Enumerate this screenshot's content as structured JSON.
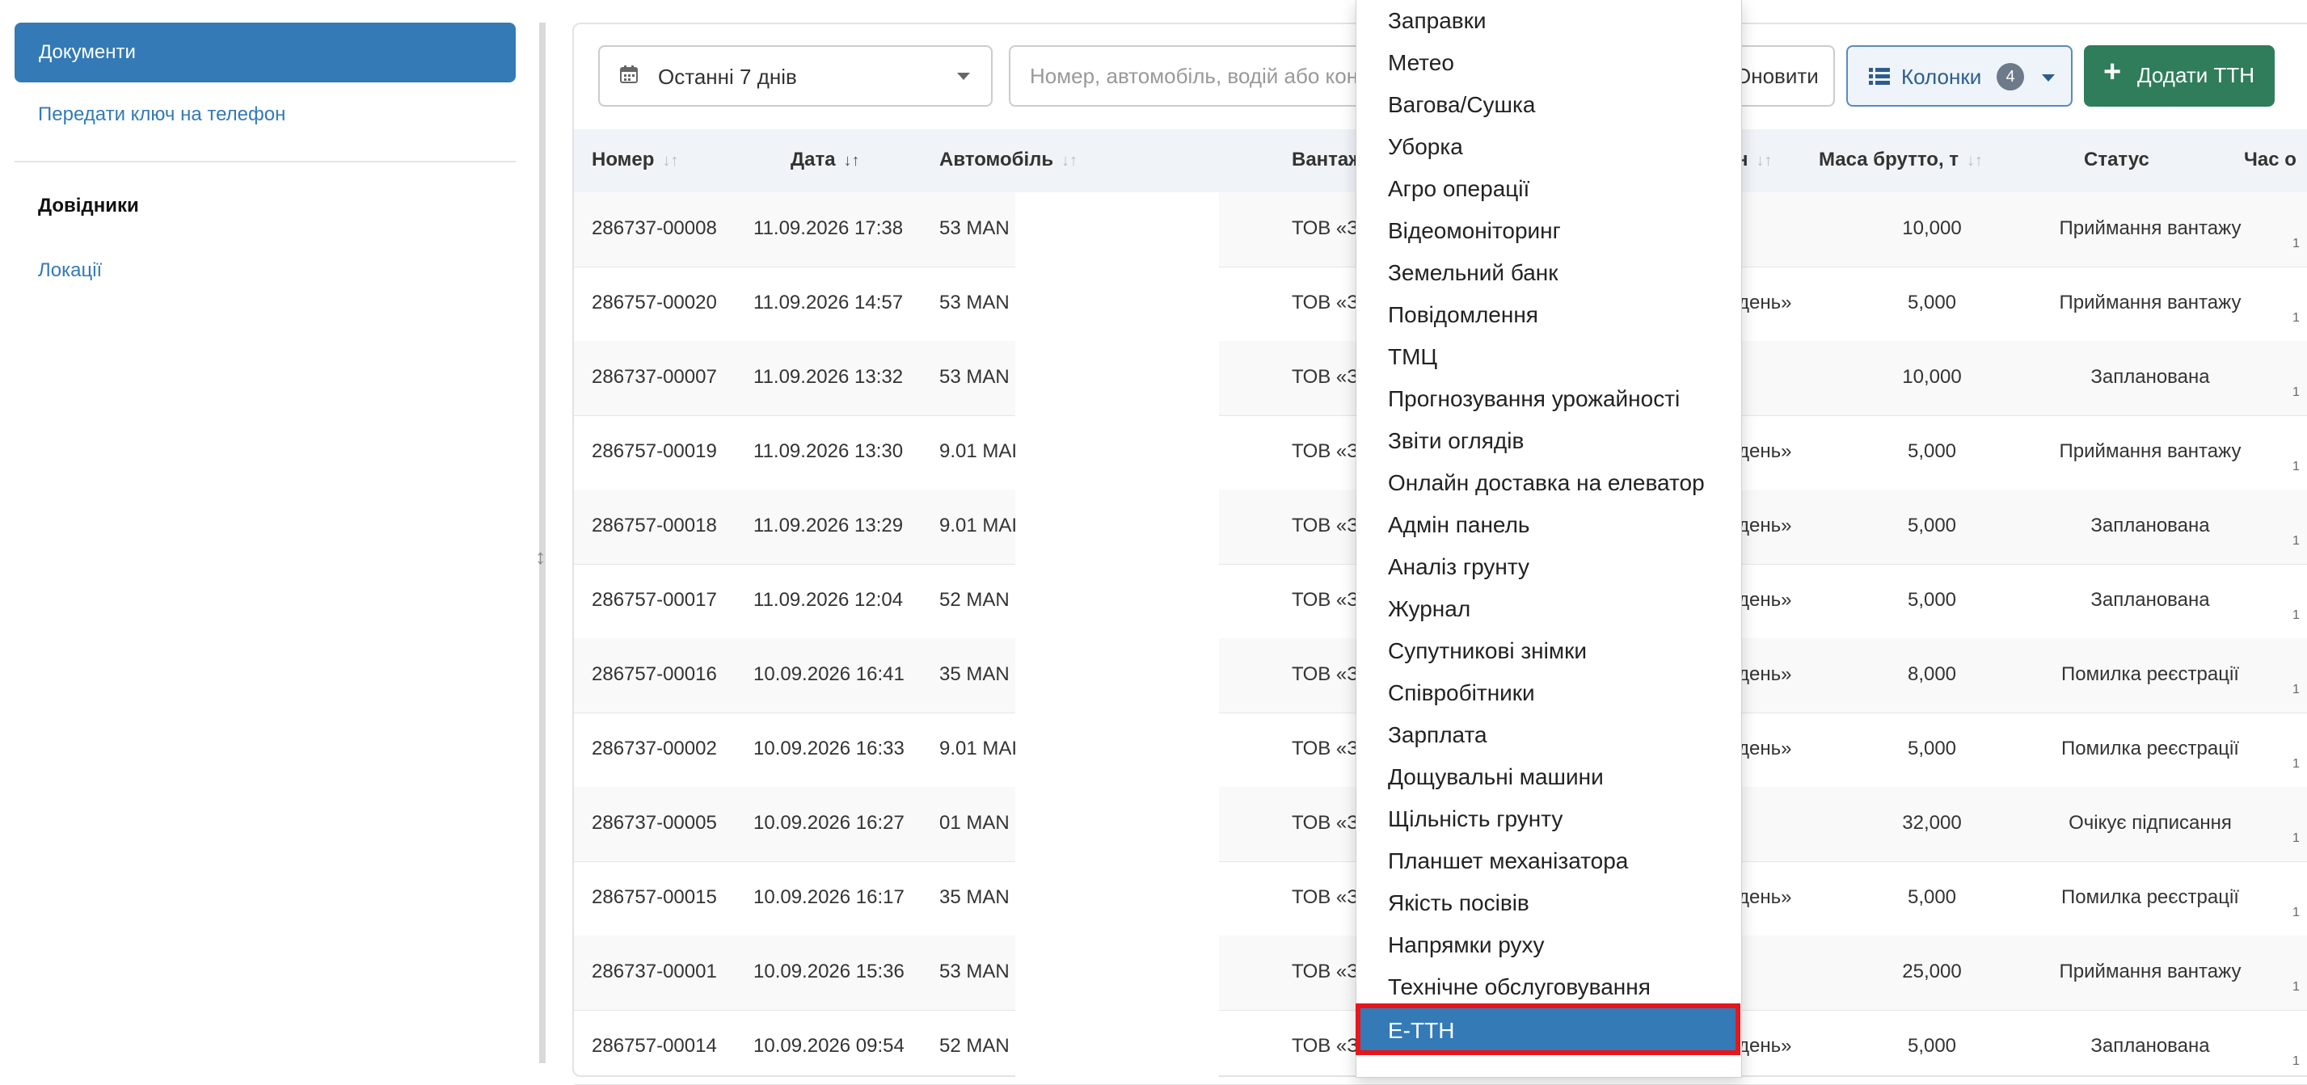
{
  "sidebar": {
    "active_item": "Документи",
    "link_send_key": "Передати ключ на телефон",
    "section_heading": "Довідники",
    "link_locations": "Локації"
  },
  "toolbar": {
    "date_range": "Останні 7 днів",
    "search_placeholder": "Номер, автомобіль, водій або контрагент",
    "refresh_label": "Оновити",
    "columns_label": "Колонки",
    "columns_count": "4",
    "add_label": "Додати ТТН"
  },
  "table": {
    "headers": {
      "number": "Номер",
      "date": "Дата",
      "vehicle": "Автомобіль",
      "cargo": "Вантаж",
      "hidden": "н",
      "gross": "Маса брутто, т",
      "status": "Статус",
      "time": "Час о"
    },
    "rows": [
      {
        "number": "286737-00008",
        "date": "11.09.2026 17:38",
        "vehicle": "53 MAN",
        "cargo": "ТОВ «З",
        "hidden": "",
        "gross": "10,000",
        "status": "Приймання вантажу"
      },
      {
        "number": "286757-00020",
        "date": "11.09.2026 14:57",
        "vehicle": "53 MAN",
        "cargo": "ТОВ «З",
        "hidden": "день»",
        "gross": "5,000",
        "status": "Приймання вантажу"
      },
      {
        "number": "286737-00007",
        "date": "11.09.2026 13:32",
        "vehicle": "53 MAN",
        "cargo": "ТОВ «З",
        "hidden": "",
        "gross": "10,000",
        "status": "Запланована"
      },
      {
        "number": "286757-00019",
        "date": "11.09.2026 13:30",
        "vehicle": "9.01 MAI",
        "cargo": "ТОВ «З",
        "hidden": "день»",
        "gross": "5,000",
        "status": "Приймання вантажу"
      },
      {
        "number": "286757-00018",
        "date": "11.09.2026 13:29",
        "vehicle": "9.01 MAI",
        "cargo": "ТОВ «З",
        "hidden": "день»",
        "gross": "5,000",
        "status": "Запланована"
      },
      {
        "number": "286757-00017",
        "date": "11.09.2026 12:04",
        "vehicle": "52 MAN",
        "cargo": "ТОВ «З",
        "hidden": "день»",
        "gross": "5,000",
        "status": "Запланована"
      },
      {
        "number": "286757-00016",
        "date": "10.09.2026 16:41",
        "vehicle": "35 MAN",
        "cargo": "ТОВ «З",
        "hidden": "день»",
        "gross": "8,000",
        "status": "Помилка реєстрації"
      },
      {
        "number": "286737-00002",
        "date": "10.09.2026 16:33",
        "vehicle": "9.01 MAI",
        "cargo": "ТОВ «З",
        "hidden": "день»",
        "gross": "5,000",
        "status": "Помилка реєстрації"
      },
      {
        "number": "286737-00005",
        "date": "10.09.2026 16:27",
        "vehicle": "01 MAN",
        "cargo": "ТОВ «З",
        "hidden": "",
        "gross": "32,000",
        "status": "Очікує підписання"
      },
      {
        "number": "286757-00015",
        "date": "10.09.2026 16:17",
        "vehicle": "35 MAN",
        "cargo": "ТОВ «З",
        "hidden": "день»",
        "gross": "5,000",
        "status": "Помилка реєстрації"
      },
      {
        "number": "286737-00001",
        "date": "10.09.2026 15:36",
        "vehicle": "53 MAN",
        "cargo": "ТОВ «З",
        "hidden": "",
        "gross": "25,000",
        "status": "Приймання вантажу"
      },
      {
        "number": "286757-00014",
        "date": "10.09.2026 09:54",
        "vehicle": "52 MAN",
        "cargo": "ТОВ «З",
        "hidden": "день»",
        "gross": "5,000",
        "status": "Запланована"
      }
    ],
    "edge_value": "1"
  },
  "menu": {
    "items": [
      "Заправки",
      "Метео",
      "Вагова/Сушка",
      "Уборка",
      "Агро операції",
      "Відеомоніторинг",
      "Земельний банк",
      "Повідомлення",
      "ТМЦ",
      "Прогнозування урожайності",
      "Звіти оглядів",
      "Онлайн доставка на елеватор",
      "Адмін панель",
      "Аналіз грунту",
      "Журнал",
      "Супутникові знімки",
      "Співробітники",
      "Зарплата",
      "Дощувальні машини",
      "Щільність грунту",
      "Планшет механізатора",
      "Якість посівів",
      "Напрямки руху",
      "Технічне обслуговування"
    ],
    "active_item": "Е-ТТН"
  },
  "colors": {
    "primary": "#337ab7",
    "success": "#2f7d5b",
    "highlight_border": "#e8151b"
  }
}
